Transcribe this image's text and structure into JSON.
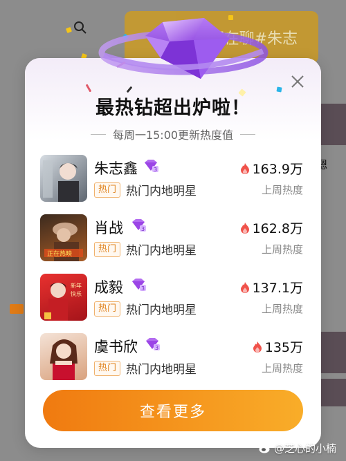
{
  "background": {
    "banner_text": "都在聊#朱志",
    "side_text": "嗯"
  },
  "modal": {
    "title": "最热钻超出炉啦！",
    "subtitle": "每周一15:00更新热度值",
    "heat_label": "上周热度",
    "tag_label": "热门",
    "cta_label": "查看更多",
    "items": [
      {
        "name": "朱志鑫",
        "category": "热门内地明星",
        "heat": "163.9万"
      },
      {
        "name": "肖战",
        "category": "热门内地明星",
        "heat": "162.8万"
      },
      {
        "name": "成毅",
        "category": "热门内地明星",
        "heat": "137.1万"
      },
      {
        "name": "虞书欣",
        "category": "热门内地明星",
        "heat": "135万"
      }
    ]
  },
  "watermark": "@芝心的小楠",
  "colors": {
    "accent_orange": "#f07a10",
    "tag_orange": "#e08420",
    "flame_red": "#f0524a",
    "gem_purple": "#9b59e8"
  },
  "icons": [
    "search-icon",
    "close-icon",
    "diamond-badge-icon",
    "flame-icon",
    "weibo-icon"
  ]
}
